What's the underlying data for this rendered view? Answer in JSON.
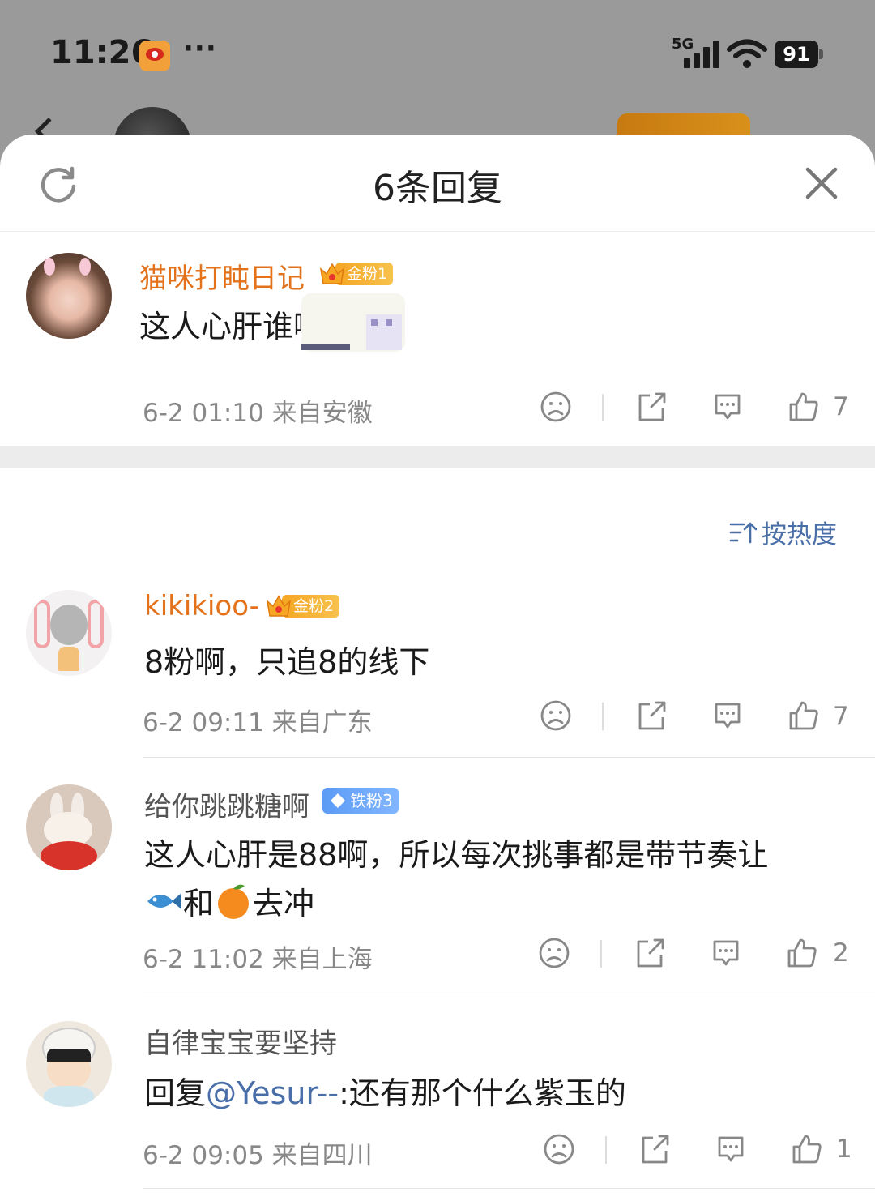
{
  "status_bar": {
    "time": "11:26",
    "more": "···",
    "network": "5G",
    "battery": "91"
  },
  "sheet": {
    "title": "6条回复"
  },
  "root_comment": {
    "user": "猫咪打盹日记",
    "badge": "金粉1",
    "text": "这人心肝谁啊",
    "meta": "6-2 01:10  来自安徽",
    "likes": "7"
  },
  "sort": {
    "label": "按热度"
  },
  "replies": [
    {
      "user": "kikikioo-",
      "badge": "金粉2",
      "text": "8粉啊，只追8的线下",
      "meta": "6-2 09:11  来自广东",
      "likes": "7"
    },
    {
      "user": "给你跳跳糖啊",
      "badge": "铁粉3",
      "text_line1": "这人心肝是88啊，所以每次挑事都是带节奏让",
      "text_line2_a": "和",
      "text_line2_b": "去冲",
      "meta": "6-2 11:02  来自上海",
      "likes": "2"
    },
    {
      "user": "自律宝宝要坚持",
      "reply_prefix": "回复",
      "mention": "@Yesur--",
      "text": ":还有那个什么紫玉的",
      "meta": "6-2 09:05  来自四川",
      "likes": "1"
    }
  ]
}
